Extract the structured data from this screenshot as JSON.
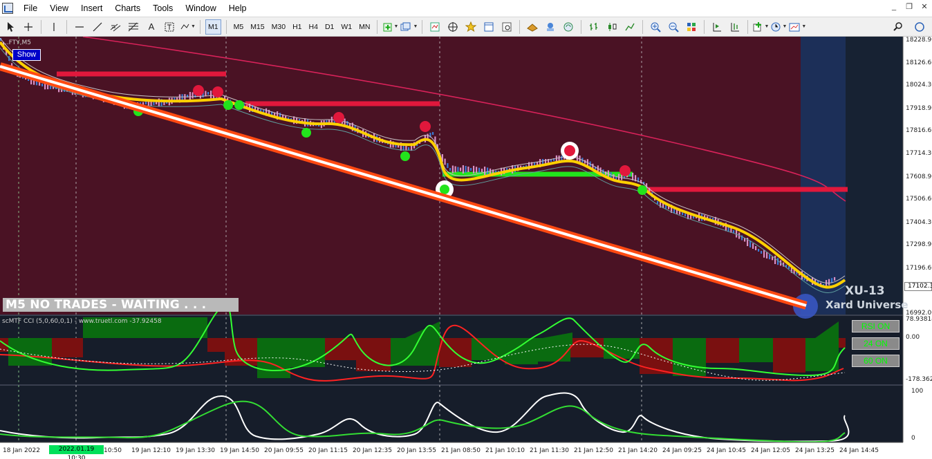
{
  "menu": {
    "items": [
      "File",
      "View",
      "Insert",
      "Charts",
      "Tools",
      "Window",
      "Help"
    ]
  },
  "toolbar": {
    "timeframes": [
      "M1",
      "M5",
      "M15",
      "M30",
      "H1",
      "H4",
      "D1",
      "W1",
      "MN"
    ],
    "active_timeframe": "M1",
    "tools": [
      "cursor-arrow",
      "crosshair",
      "vertical-line",
      "horizontal-line",
      "trendline",
      "equidistant-channel",
      "fibonacci",
      "text",
      "text-label",
      "shapes",
      "new-chart",
      "profiles",
      "market-watch",
      "data-window",
      "navigator",
      "terminal",
      "strategy-tester",
      "market",
      "signals",
      "bar-chart",
      "candlesticks",
      "line-chart",
      "zoom-in",
      "zoom-out",
      "tile-windows",
      "autoscroll",
      "chart-shift",
      "indicators",
      "periods",
      "templates",
      "search"
    ]
  },
  "chart": {
    "symbol": "...FTY,M5",
    "show_label": "Show",
    "status_text": "M5  NO TRADES - WAITING . . .",
    "brand_code": "XU-13",
    "brand_name": "Xard Universe",
    "current_price": "17102.30",
    "price_ticks": [
      "18228.90",
      "18126.60",
      "18024.30",
      "17918.90",
      "17816.60",
      "17714.30",
      "17608.90",
      "17506.60",
      "17404.30",
      "17298.90",
      "17196.60",
      "17102.30",
      "16992.00"
    ],
    "colors": {
      "background_main": "#4a1224",
      "highlight_zone": "#1c2f58",
      "trend_channel": "#ff4a12",
      "ma_line": "#ffd000",
      "pivot_red": "#e1183c",
      "pivot_green": "#22e41c"
    }
  },
  "cci": {
    "label": "scMTF CCI (5,0,60,0,1) - www.truetl.com -37.92458",
    "scale_ticks": [
      "78.93814",
      "0.00",
      "-178.36200"
    ],
    "toggles": [
      "RSI ON",
      "24 ON",
      "60 ON"
    ]
  },
  "oscillator": {
    "scale_ticks": [
      "100",
      "0"
    ]
  },
  "time_axis": {
    "cursor_label": "2022.01.19 10:30",
    "labels": [
      "18 Jan 2022",
      "19 Jan 10:50",
      "19 Jan 12:10",
      "19 Jan 13:30",
      "19 Jan 14:50",
      "20 Jan 09:55",
      "20 Jan 11:15",
      "20 Jan 12:35",
      "20 Jan 13:55",
      "21 Jan 08:50",
      "21 Jan 10:10",
      "21 Jan 11:30",
      "21 Jan 12:50",
      "21 Jan 14:20",
      "24 Jan 09:25",
      "24 Jan 10:45",
      "24 Jan 12:05",
      "24 Jan 13:25",
      "24 Jan 14:45"
    ]
  }
}
